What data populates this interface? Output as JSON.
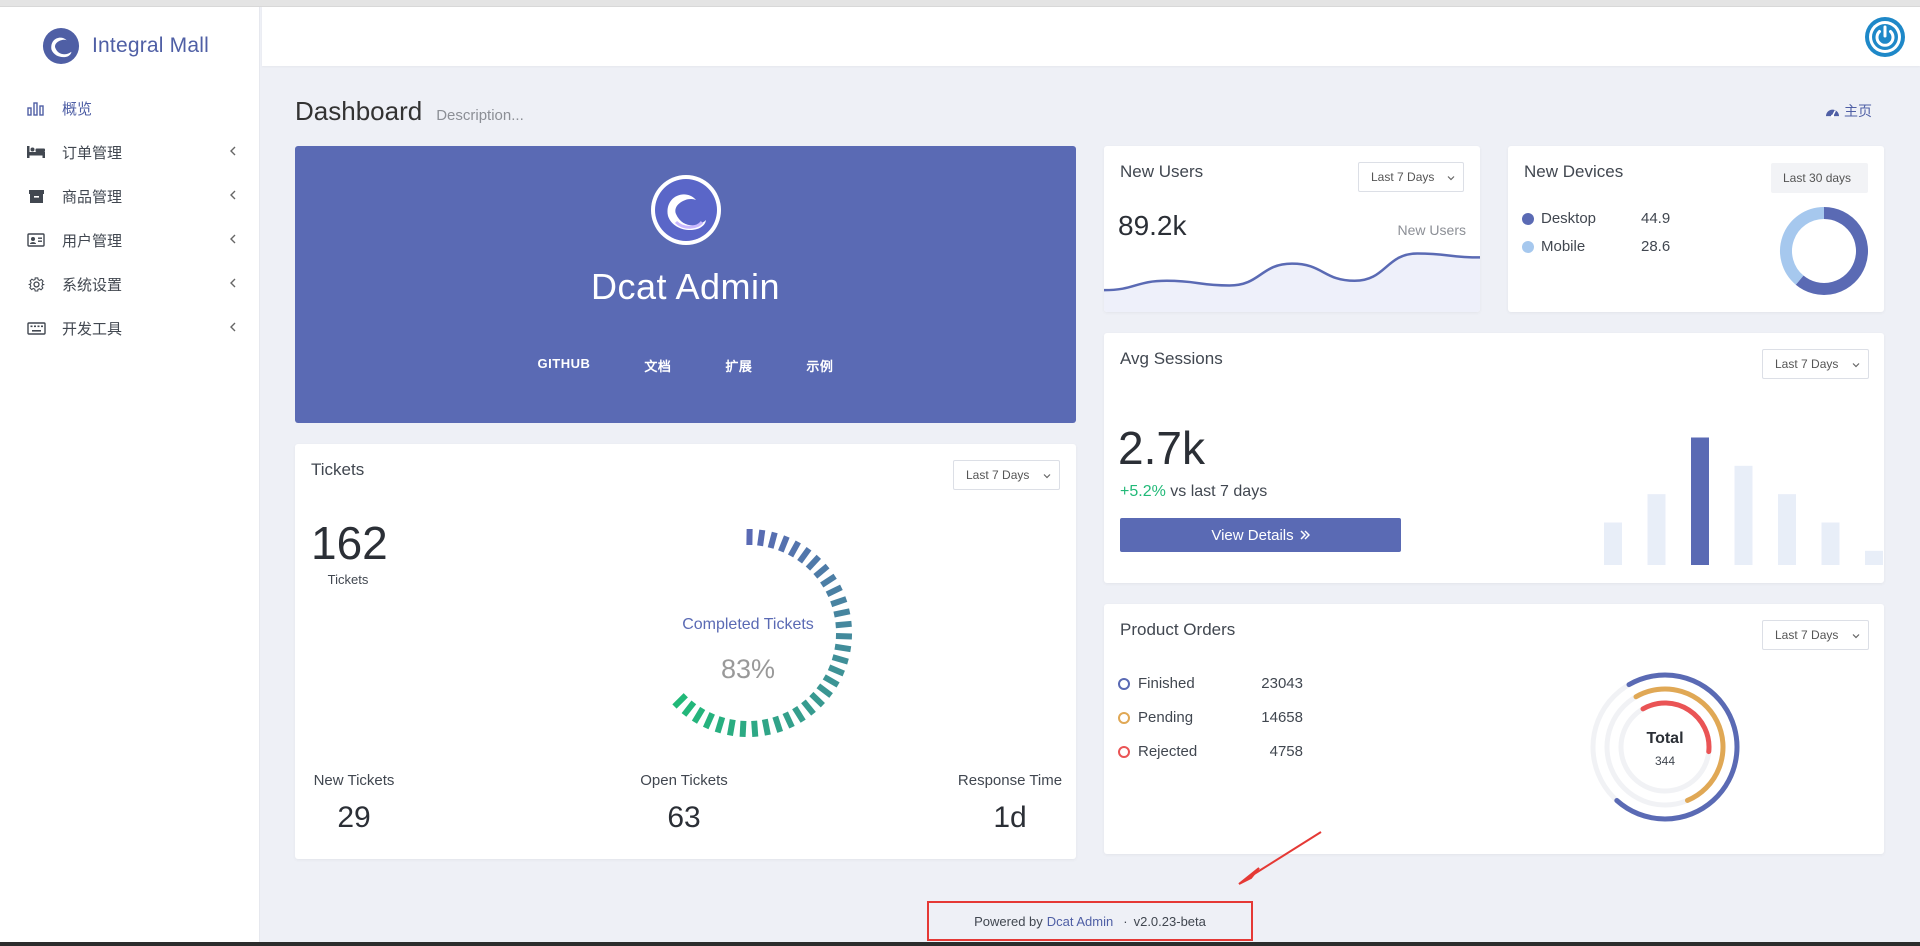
{
  "brand": {
    "name": "Integral Mall"
  },
  "sidebar": {
    "items": [
      {
        "label": "概览",
        "icon": "bar-chart-icon",
        "active": true,
        "has_arrow": false
      },
      {
        "label": "订单管理",
        "icon": "bed-icon",
        "active": false,
        "has_arrow": true
      },
      {
        "label": "商品管理",
        "icon": "archive-icon",
        "active": false,
        "has_arrow": true
      },
      {
        "label": "用户管理",
        "icon": "id-card-icon",
        "active": false,
        "has_arrow": true
      },
      {
        "label": "系统设置",
        "icon": "gear-icon",
        "active": false,
        "has_arrow": true
      },
      {
        "label": "开发工具",
        "icon": "keyboard-icon",
        "active": false,
        "has_arrow": true
      }
    ]
  },
  "page": {
    "title": "Dashboard",
    "description": "Description...",
    "breadcrumb": "主页"
  },
  "banner": {
    "title": "Dcat Admin",
    "links": [
      "GITHUB",
      "文档",
      "扩展",
      "示例"
    ]
  },
  "new_users": {
    "title": "New Users",
    "range": "Last 7 Days",
    "value": "89.2k",
    "series_label": "New Users"
  },
  "new_devices": {
    "title": "New Devices",
    "range": "Last 30 days",
    "items": [
      {
        "label": "Desktop",
        "value": "44.9",
        "color": "#5a6ab4"
      },
      {
        "label": "Mobile",
        "value": "28.6",
        "color": "#a6c8ee"
      }
    ]
  },
  "avg_sessions": {
    "title": "Avg Sessions",
    "range": "Last 7 Days",
    "value": "2.7k",
    "change": "+5.2%",
    "change_suffix": "vs last 7 days",
    "button": "View Details"
  },
  "tickets": {
    "title": "Tickets",
    "range": "Last 7 Days",
    "count": "162",
    "count_label": "Tickets",
    "gauge_label": "Completed Tickets",
    "gauge_value": "83%",
    "stats": [
      {
        "label": "New Tickets",
        "value": "29"
      },
      {
        "label": "Open Tickets",
        "value": "63"
      },
      {
        "label": "Response Time",
        "value": "1d"
      }
    ]
  },
  "product_orders": {
    "title": "Product Orders",
    "range": "Last 7 Days",
    "items": [
      {
        "label": "Finished",
        "value": "23043",
        "color": "#5a6ab4"
      },
      {
        "label": "Pending",
        "value": "14658",
        "color": "#e0a855"
      },
      {
        "label": "Rejected",
        "value": "4758",
        "color": "#ea5455"
      }
    ],
    "total_label": "Total",
    "total_value": "344"
  },
  "footer": {
    "prefix": "Powered by",
    "link": "Dcat Admin",
    "separator": "·",
    "version": "v2.0.23-beta"
  },
  "colors": {
    "primary": "#5a6ab4",
    "success": "#21b978",
    "light_bar": "#e8eef8"
  },
  "chart_data": [
    {
      "type": "area",
      "series": [
        {
          "name": "New Users",
          "values": [
            28,
            40,
            34,
            62,
            40,
            75,
            70
          ]
        }
      ]
    },
    {
      "type": "pie",
      "categories": [
        "Desktop",
        "Mobile"
      ],
      "values": [
        44.9,
        28.6
      ]
    },
    {
      "type": "bar",
      "values": [
        45,
        75,
        135,
        105,
        75,
        45,
        15
      ],
      "highlight_index": 2
    },
    {
      "type": "radialBar",
      "values": [
        83
      ]
    },
    {
      "type": "radialBar",
      "categories": [
        "Finished",
        "Pending",
        "Rejected"
      ],
      "values": [
        70,
        52,
        35
      ]
    }
  ]
}
